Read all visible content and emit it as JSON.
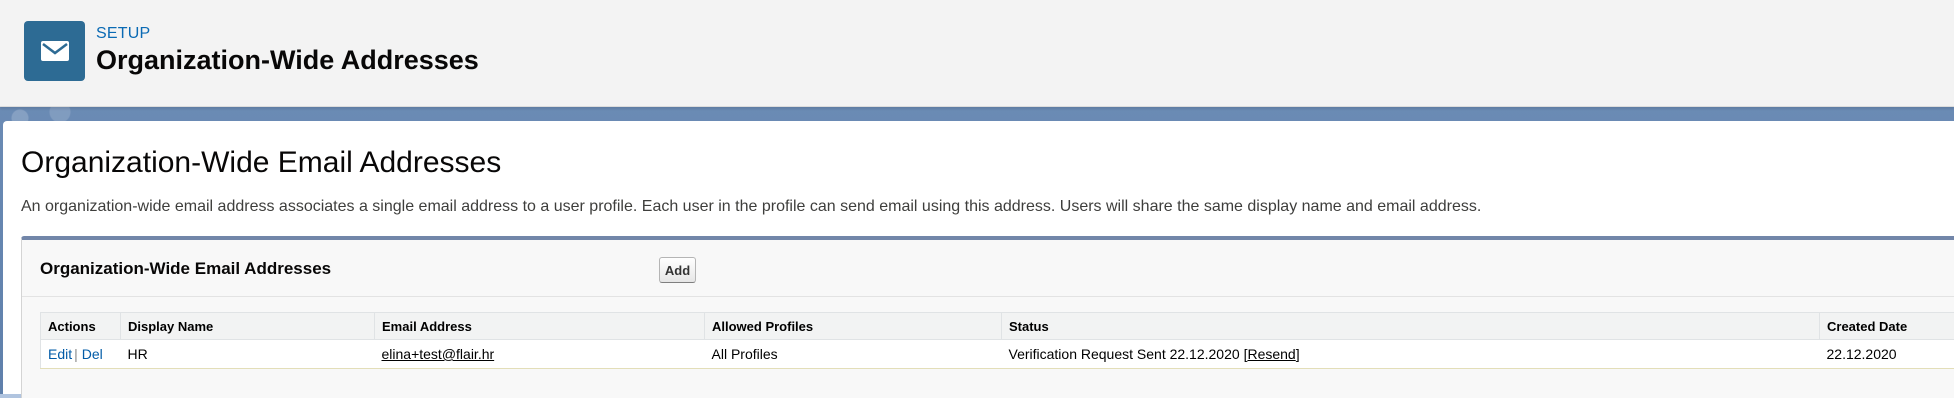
{
  "header": {
    "icon": "envelope-icon",
    "eyebrow": "SETUP",
    "title": "Organization-Wide Addresses"
  },
  "page": {
    "heading": "Organization-Wide Email Addresses",
    "description": "An organization-wide email address associates a single email address to a user profile. Each user in the profile can send email using this address. Users will share the same display name and email address."
  },
  "section": {
    "title": "Organization-Wide Email Addresses",
    "add_label": "Add"
  },
  "table": {
    "columns": [
      "Actions",
      "Display Name",
      "Email Address",
      "Allowed Profiles",
      "Status",
      "Created Date"
    ],
    "rows": [
      {
        "edit": "Edit",
        "separator": "|",
        "del": "Del",
        "display_name": "HR",
        "email": "elina+test@flair.hr",
        "allowed_profiles": "All Profiles",
        "status_text": "Verification Request Sent 22.12.2020",
        "resend_open": "[",
        "resend": "Resend",
        "resend_close": "]",
        "created_date": "22.12.2020"
      }
    ]
  },
  "colors": {
    "header_icon_bg": "#2d6b94",
    "eyebrow": "#0a6ab4",
    "link": "#015ba7",
    "section_border": "#7286a9"
  }
}
